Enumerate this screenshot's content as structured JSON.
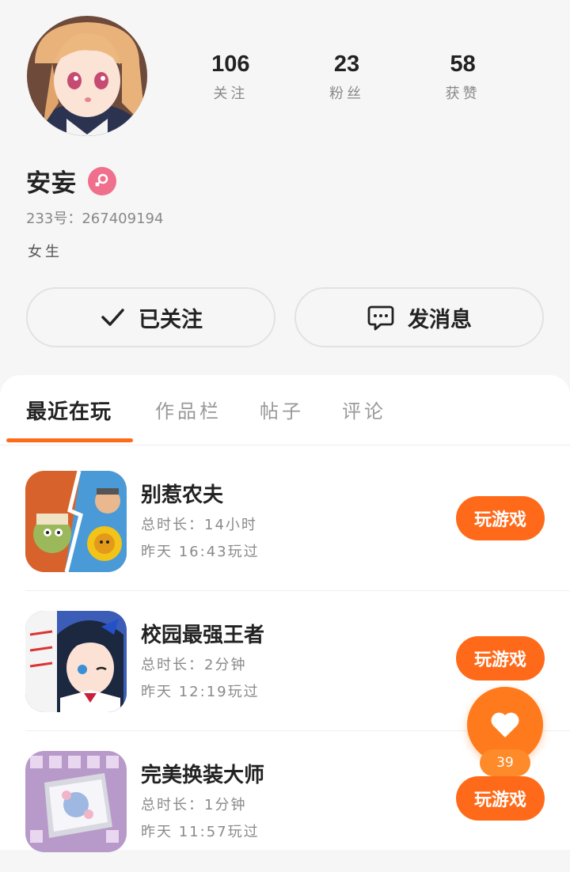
{
  "profile": {
    "name": "安妄",
    "uid": "233号：267409194",
    "bio": "女生",
    "gender_icon": "female-icon"
  },
  "stats": [
    {
      "value": "106",
      "label": "关注"
    },
    {
      "value": "23",
      "label": "粉丝"
    },
    {
      "value": "58",
      "label": "获赞"
    }
  ],
  "actions": {
    "follow_label": "已关注",
    "message_label": "发消息"
  },
  "tabs": [
    {
      "label": "最近在玩"
    },
    {
      "label": "作品栏"
    },
    {
      "label": "帖子"
    },
    {
      "label": "评论"
    }
  ],
  "games": [
    {
      "title": "别惹农夫",
      "total": "总时长：14小时",
      "last": "昨天 16:43玩过",
      "play_label": "玩游戏"
    },
    {
      "title": "校园最强王者",
      "total": "总时长：2分钟",
      "last": "昨天 12:19玩过",
      "play_label": "玩游戏"
    },
    {
      "title": "完美换装大师",
      "total": "总时长：1分钟",
      "last": "昨天 11:57玩过",
      "play_label": "玩游戏"
    }
  ],
  "like": {
    "count": "39"
  },
  "colors": {
    "accent": "#ff6a1a",
    "gender_badge": "#ef6f8d",
    "background": "#f6f6f6"
  }
}
